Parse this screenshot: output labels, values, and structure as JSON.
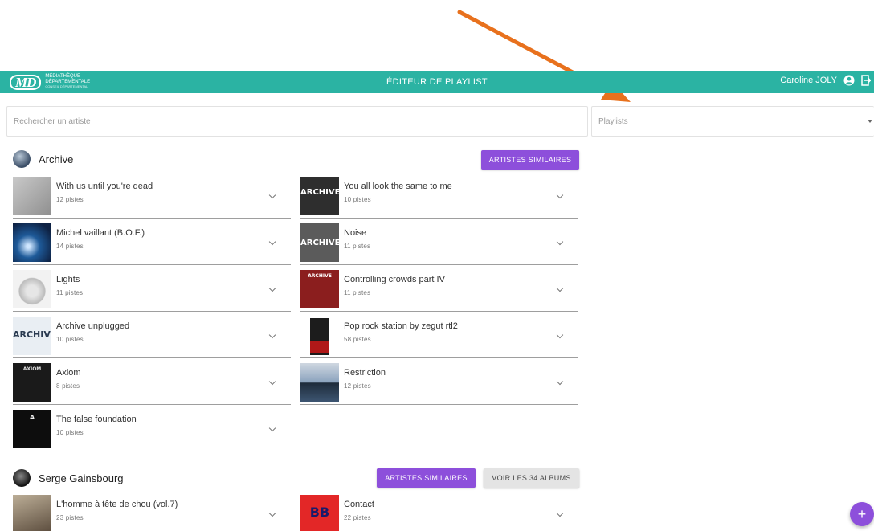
{
  "annotation": {
    "arrow_color": "#e8711d"
  },
  "header": {
    "logo_mark": "MD",
    "logo_line1": "MÉDIATHÈQUE",
    "logo_line2": "DÉPARTEMENTALE",
    "logo_line3": "Conseil départemental",
    "title": "ÉDITEUR DE PLAYLIST",
    "user_name": "Caroline JOLY",
    "account_icon": "account-circle-icon",
    "logout_icon": "logout-icon",
    "bar_color": "#2bb3a3"
  },
  "search": {
    "placeholder": "Rechercher un artiste"
  },
  "playlists": {
    "placeholder": "Playlists"
  },
  "artists": [
    {
      "name": "Archive",
      "similar_label": "ARTISTES SIMILAIRES",
      "albums": [
        {
          "title": "With us until you're dead",
          "count": "12 pistes"
        },
        {
          "title": "You all look the same to me",
          "count": "10 pistes"
        },
        {
          "title": "Michel vaillant (B.O.F.)",
          "count": "14 pistes"
        },
        {
          "title": "Noise",
          "count": "11 pistes"
        },
        {
          "title": "Lights",
          "count": "11 pistes"
        },
        {
          "title": "Controlling crowds part IV",
          "count": "11 pistes"
        },
        {
          "title": "Archive unplugged",
          "count": "10 pistes"
        },
        {
          "title": "Pop rock station by zegut rtl2",
          "count": "58 pistes"
        },
        {
          "title": "Axiom",
          "count": "8 pistes"
        },
        {
          "title": "Restriction",
          "count": "12 pistes"
        },
        {
          "title": "The false foundation",
          "count": "10 pistes"
        }
      ]
    },
    {
      "name": "Serge Gainsbourg",
      "similar_label": "ARTISTES SIMILAIRES",
      "all_albums_label": "VOIR LES 34 ALBUMS",
      "albums": [
        {
          "title": "L'homme à tête de chou (vol.7)",
          "count": "23 pistes"
        },
        {
          "title": "Contact",
          "count": "22 pistes"
        }
      ]
    }
  ],
  "cover_text": {
    "archive": "ARCHIVE",
    "axiom": "AXIOM",
    "false_foundation": "A",
    "contact": "BB"
  },
  "fab": {
    "label": "+"
  },
  "accent_color": "#8d4fdb"
}
